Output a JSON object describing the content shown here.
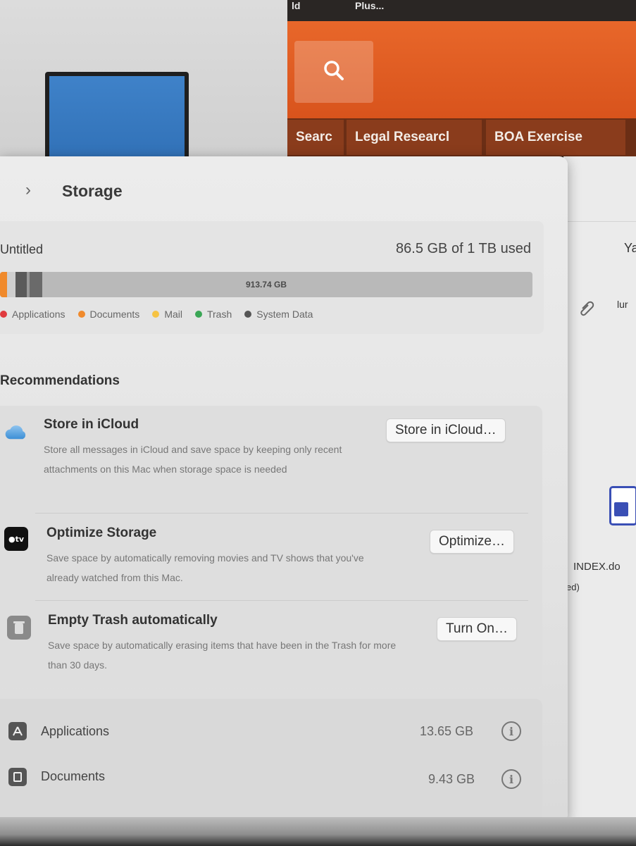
{
  "background": {
    "top_bar_fragments": [
      "ld",
      "Plus..."
    ],
    "tabs": [
      "Searc",
      "Legal Researcl",
      "BOA Exercise"
    ],
    "right_fragments": [
      "Ya",
      "lur",
      "INDEX.do",
      "ed)"
    ]
  },
  "window": {
    "title": "Storage",
    "disk": {
      "name": "Untitled",
      "usage_text": "86.5 GB of 1 TB used",
      "bar_label": "913.74 GB",
      "used_fraction": 0.0865
    },
    "legend": [
      {
        "label": "Applications",
        "color": "#e03a3e"
      },
      {
        "label": "Documents",
        "color": "#f08a2c"
      },
      {
        "label": "Mail",
        "color": "#f6c343"
      },
      {
        "label": "Trash",
        "color": "#3aa655"
      },
      {
        "label": "System Data",
        "color": "#555555"
      }
    ],
    "recommendations_heading": "Recommendations",
    "recommendations": [
      {
        "title": "Store in iCloud",
        "description": "Store all messages in iCloud and save space by keeping only recent attachments on this Mac when storage space is needed",
        "button": "Store in iCloud…",
        "icon": "icloud-icon"
      },
      {
        "title": "Optimize Storage",
        "description": "Save space by automatically removing movies and TV shows that you've already watched from this Mac.",
        "button": "Optimize…",
        "icon": "apple-tv-icon"
      },
      {
        "title": "Empty Trash automatically",
        "description": "Save space by automatically erasing items that have been in the Trash for more than 30 days.",
        "button": "Turn On…",
        "icon": "trash-icon"
      }
    ],
    "categories": [
      {
        "label": "Applications",
        "size": "13.65 GB",
        "icon": "applications-icon"
      },
      {
        "label": "Documents",
        "size": "9.43 GB",
        "icon": "documents-icon"
      }
    ]
  },
  "colors": {
    "accent_orange": "#e0602a",
    "bar_background": "#b9b9b9"
  }
}
